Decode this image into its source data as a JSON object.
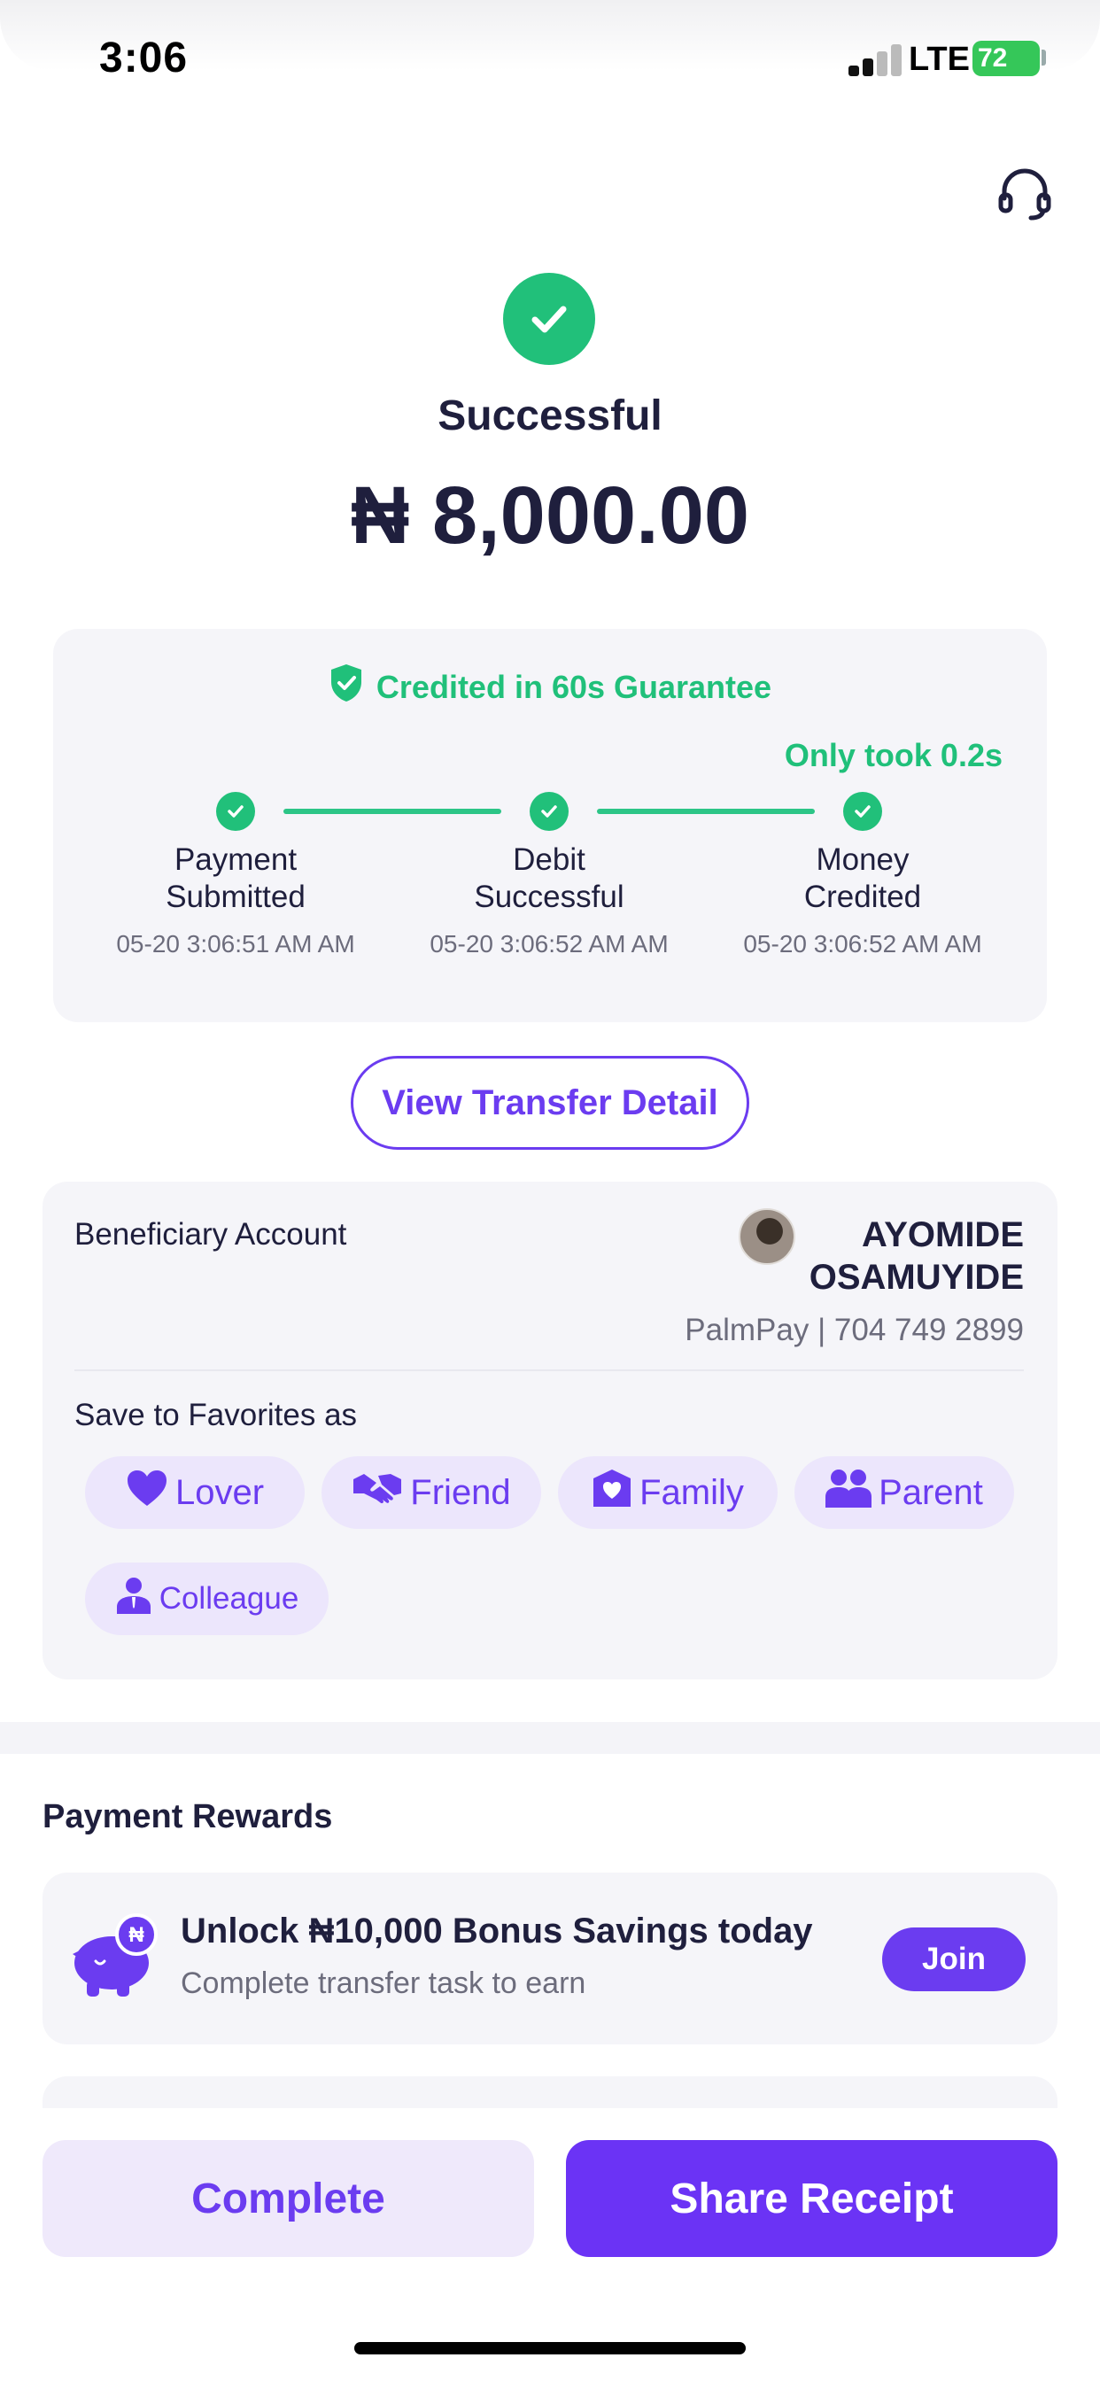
{
  "status_bar": {
    "time": "3:06",
    "network": "LTE",
    "battery": "72"
  },
  "header": {
    "support_icon": "headset-icon"
  },
  "result": {
    "status": "Successful",
    "amount": "₦ 8,000.00",
    "icon": "check-circle-icon"
  },
  "guarantee": {
    "title": "Credited in 60s Guarantee",
    "speed_note": "Only took 0.2s",
    "steps": [
      {
        "label": "Payment\nSubmitted",
        "time": "05-20 3:06:51 AM AM"
      },
      {
        "label": "Debit\nSuccessful",
        "time": "05-20 3:06:52 AM AM"
      },
      {
        "label": "Money\nCredited",
        "time": "05-20 3:06:52 AM AM"
      }
    ]
  },
  "view_detail_label": "View Transfer Detail",
  "beneficiary": {
    "label": "Beneficiary Account",
    "name": "AYOMIDE\nOSAMUYIDE",
    "account": "PalmPay | 704 749 2899",
    "favorites_label": "Save to Favorites as",
    "favorites": [
      {
        "label": "Lover",
        "icon": "heart-icon"
      },
      {
        "label": "Friend",
        "icon": "handshake-icon"
      },
      {
        "label": "Family",
        "icon": "home-heart-icon"
      },
      {
        "label": "Parent",
        "icon": "people-icon"
      },
      {
        "label": "Colleague",
        "icon": "colleague-icon"
      }
    ]
  },
  "rewards": {
    "title": "Payment Rewards",
    "offer_title": "Unlock ₦10,000 Bonus Savings today",
    "offer_sub": "Complete transfer task to earn",
    "join_label": "Join",
    "icon": "piggy-bank-icon"
  },
  "actions": {
    "complete_label": "Complete",
    "share_label": "Share Receipt"
  },
  "colors": {
    "accent": "#6b3cf0",
    "success": "#21c07a"
  }
}
